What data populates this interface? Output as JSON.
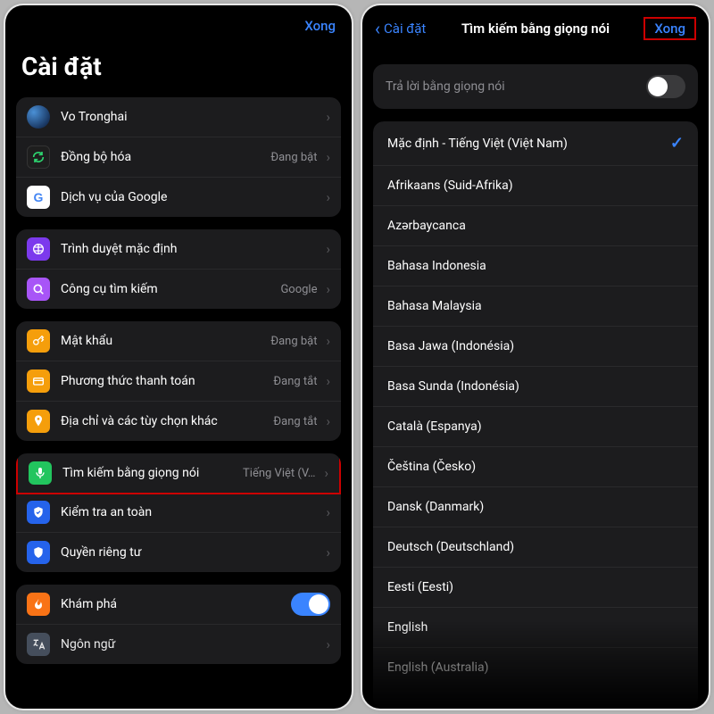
{
  "colors": {
    "accent": "#3a84ff",
    "highlight": "#c00"
  },
  "left": {
    "done": "Xong",
    "title": "Cài đặt",
    "account": {
      "name": "Vo Tronghai"
    },
    "group1": [
      {
        "icon": "sync-icon",
        "label": "Đồng bộ hóa",
        "detail": "Đang bật"
      },
      {
        "icon": "google-icon",
        "label": "Dịch vụ của Google",
        "detail": ""
      }
    ],
    "group2": [
      {
        "icon": "browser-icon",
        "label": "Trình duyệt mặc định",
        "detail": ""
      },
      {
        "icon": "search-icon",
        "label": "Công cụ tìm kiếm",
        "detail": "Google"
      }
    ],
    "group3": [
      {
        "icon": "key-icon",
        "label": "Mật khẩu",
        "detail": "Đang bật"
      },
      {
        "icon": "card-icon",
        "label": "Phương thức thanh toán",
        "detail": "Đang tắt"
      },
      {
        "icon": "pin-icon",
        "label": "Địa chỉ và các tùy chọn khác",
        "detail": "Đang tắt"
      }
    ],
    "voice_row": {
      "icon": "mic-icon",
      "label": "Tìm kiếm bằng giọng nói",
      "detail": "Tiếng Việt (V…"
    },
    "group4": [
      {
        "icon": "shield-icon",
        "label": "Kiểm tra an toàn"
      },
      {
        "icon": "privacy-icon",
        "label": "Quyền riêng tư"
      }
    ],
    "explore_row": {
      "icon": "flame-icon",
      "label": "Khám phá"
    },
    "language_row": {
      "icon": "language-icon",
      "label": "Ngôn ngữ"
    }
  },
  "right": {
    "back": "Cài đặt",
    "title": "Tìm kiếm bằng giọng nói",
    "done": "Xong",
    "voice_reply_label": "Trả lời bằng giọng nói",
    "voice_reply_on": false,
    "selected_index": 0,
    "languages": [
      "Mặc định - Tiếng Việt (Việt Nam)",
      "Afrikaans (Suid-Afrika)",
      "Azərbaycanca",
      "Bahasa Indonesia",
      "Bahasa Malaysia",
      "Basa Jawa (Indonésia)",
      "Basa Sunda (Indonésia)",
      "Català (Espanya)",
      "Čeština (Česko)",
      "Dansk (Danmark)",
      "Deutsch (Deutschland)",
      "Eesti (Eesti)",
      "English",
      "English (Australia)"
    ]
  }
}
